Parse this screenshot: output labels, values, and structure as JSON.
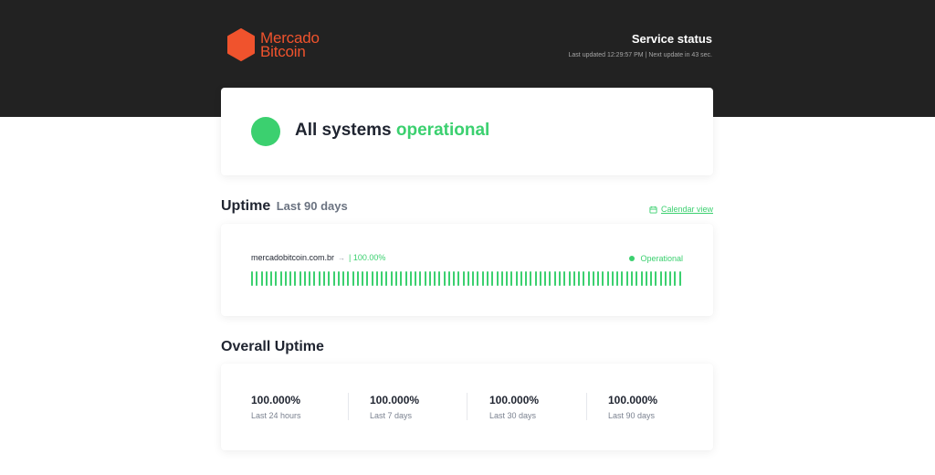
{
  "header": {
    "brand_line1": "Mercado",
    "brand_line2": "Bitcoin",
    "title": "Service status",
    "subtitle": "Last updated 12:29:57 PM | Next update in 43 sec."
  },
  "status": {
    "text_prefix": "All systems",
    "text_status": "operational"
  },
  "uptime": {
    "title": "Uptime",
    "period": "Last 90 days",
    "calendar_link": "Calendar view",
    "site": "mercadobitcoin.com.br",
    "arrow": "→",
    "percent": "| 100.00%",
    "site_status": "Operational",
    "bar_count": 90
  },
  "overall": {
    "title": "Overall Uptime",
    "stats": [
      {
        "value": "100.000%",
        "label": "Last 24 hours"
      },
      {
        "value": "100.000%",
        "label": "Last 7 days"
      },
      {
        "value": "100.000%",
        "label": "Last 30 days"
      },
      {
        "value": "100.000%",
        "label": "Last 90 days"
      }
    ]
  },
  "colors": {
    "brand": "#f0532d",
    "operational": "#3bd06f",
    "header_bg": "#222222"
  }
}
